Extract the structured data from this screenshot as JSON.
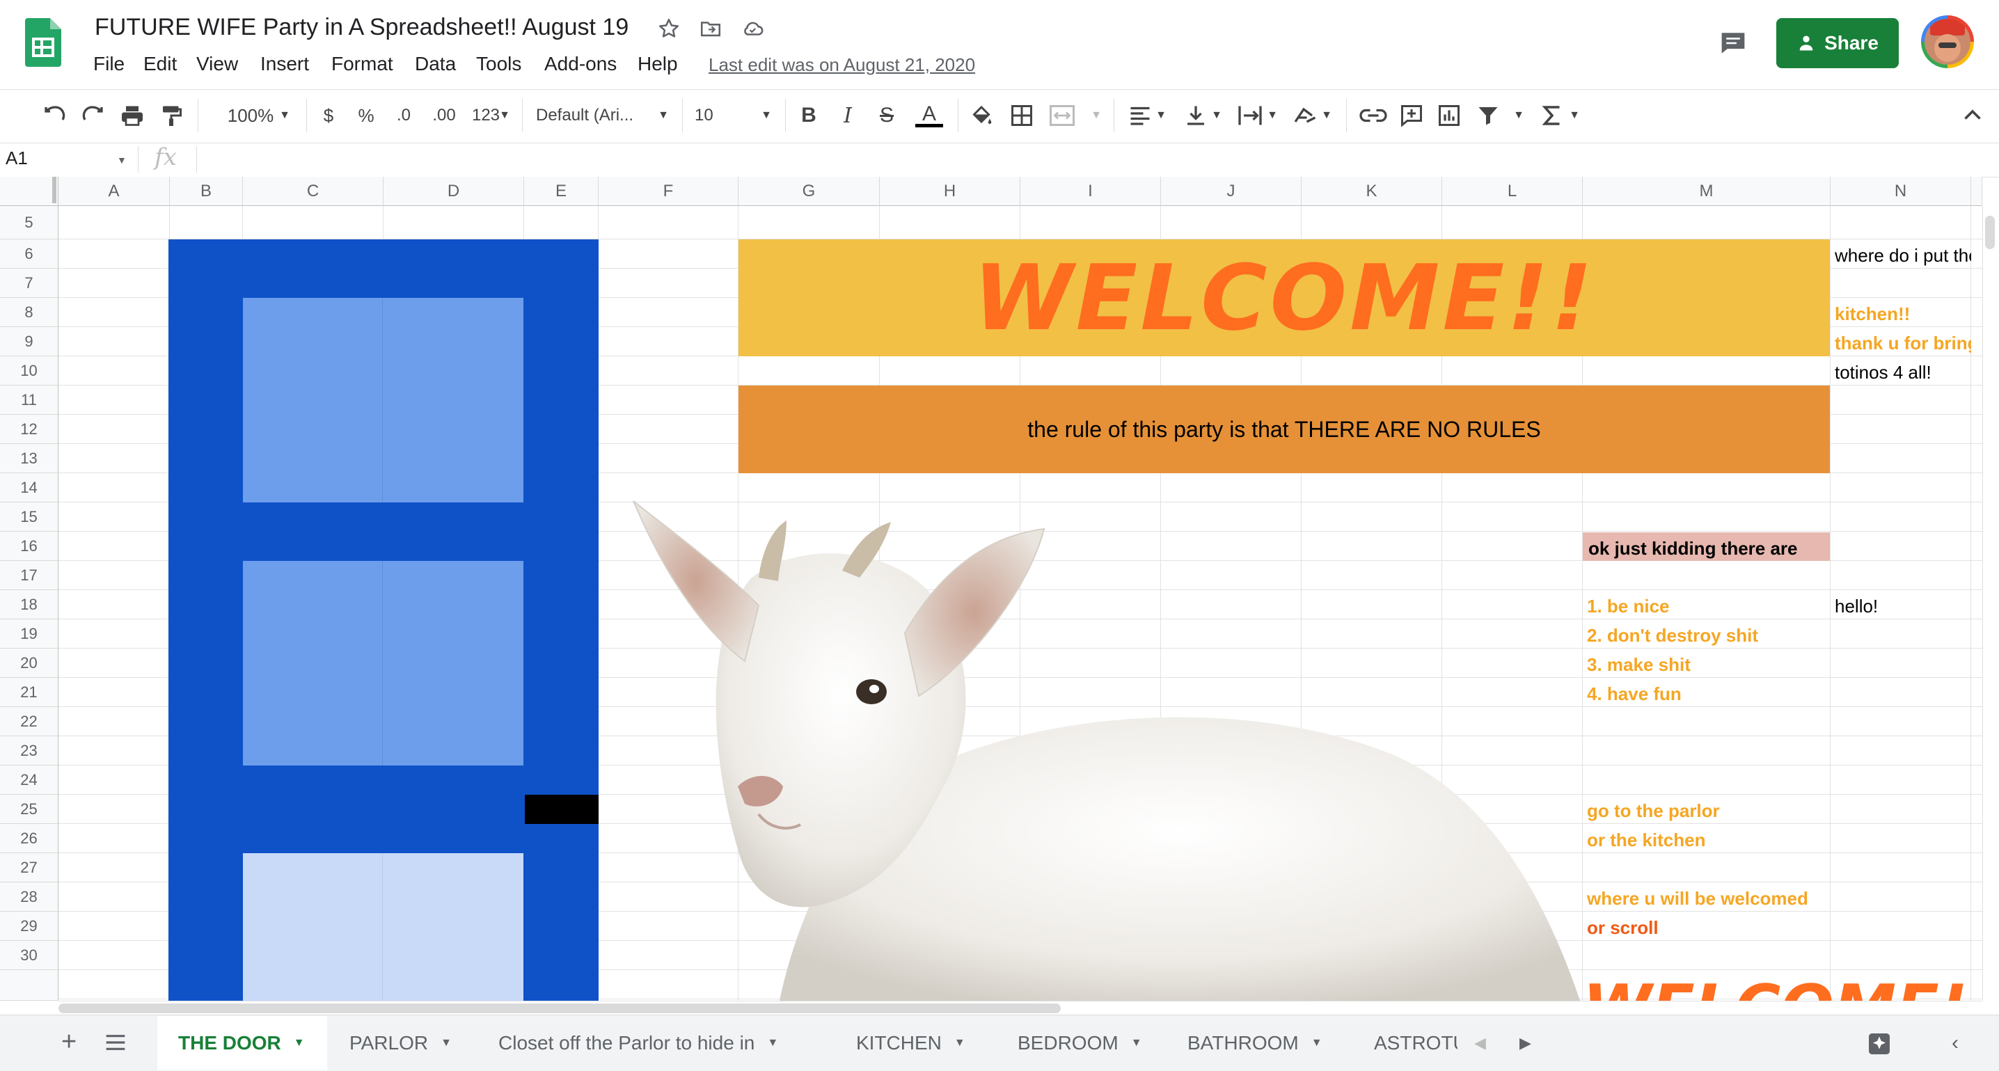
{
  "app": {
    "title": "FUTURE WIFE Party in A Spreadsheet!! August 19",
    "last_edit": "Last edit was on August 21, 2020",
    "share_label": "Share",
    "brand_color": "#188038"
  },
  "menu": [
    "File",
    "Edit",
    "View",
    "Insert",
    "Format",
    "Data",
    "Tools",
    "Add-ons",
    "Help"
  ],
  "toolbar": {
    "zoom": "100%",
    "currency": "$",
    "percent": "%",
    "dec_decrease": ".0",
    "dec_increase": ".00",
    "more_formats": "123",
    "font": "Default (Ari...",
    "font_size": "10",
    "bold": "B",
    "italic": "I",
    "strike": "S",
    "text_color": "A"
  },
  "formula_bar": {
    "cell_ref": "A1",
    "fx": "fx",
    "value": ""
  },
  "columns": [
    "A",
    "B",
    "C",
    "D",
    "E",
    "F",
    "G",
    "H",
    "I",
    "J",
    "K",
    "L",
    "M",
    "N"
  ],
  "rows": [
    "5",
    "6",
    "7",
    "8",
    "9",
    "10",
    "11",
    "12",
    "13",
    "14",
    "15",
    "16",
    "17",
    "18",
    "19",
    "20",
    "21",
    "22",
    "23",
    "24",
    "25",
    "26",
    "27",
    "28",
    "29",
    "30"
  ],
  "cells": {
    "welcome": "WELCOME!!",
    "rule": "the rule of this party is that THERE ARE NO RULES",
    "kidding": "ok just kidding there are",
    "rule1": "1. be nice",
    "rule2": "2. don't destroy shit",
    "rule3": "3. make shit",
    "rule4": "4. have fun",
    "parlor": "go to the parlor",
    "kitchen": "or the kitchen",
    "welcomed": "where u will be welcomed",
    "scroll": "or scroll",
    "bottom_welcome": "WELCOME!!",
    "n6": "where do i put the",
    "n8": "kitchen!!",
    "n9": "thank u for bring",
    "n10": "totinos 4 all!",
    "n18": "hello!"
  },
  "colors": {
    "door_blue": "#0f52c8",
    "panel_light": "#6d9eeb",
    "panel_lighter": "#c9daf8",
    "welcome_bg": "#f1c045",
    "welcome_text": "#ff6d1f",
    "rule_bg": "#e69138",
    "kidding_bg": "#e6b8af",
    "list_orange": "#f5a623"
  },
  "sheet_tabs": [
    "THE DOOR",
    "PARLOR",
    "Closet off the Parlor to hide in",
    "KITCHEN",
    "BEDROOM",
    "BATHROOM",
    "ASTROTU"
  ],
  "active_tab": "THE DOOR",
  "icons": {
    "undo": "undo-icon",
    "redo": "redo-icon",
    "print": "print-icon",
    "paint_format": "paint-format-icon",
    "fill": "fill-color-icon",
    "borders": "borders-icon",
    "merge": "merge-cells-icon",
    "halign": "align-left-icon",
    "valign": "valign-bottom-icon",
    "wrap": "text-wrap-icon",
    "rotate": "text-rotate-icon",
    "link": "link-icon",
    "comment": "insert-comment-icon",
    "chart": "insert-chart-icon",
    "filter": "filter-icon",
    "functions": "functions-icon",
    "collapse": "chevron-up-icon",
    "explore": "explore-icon"
  }
}
